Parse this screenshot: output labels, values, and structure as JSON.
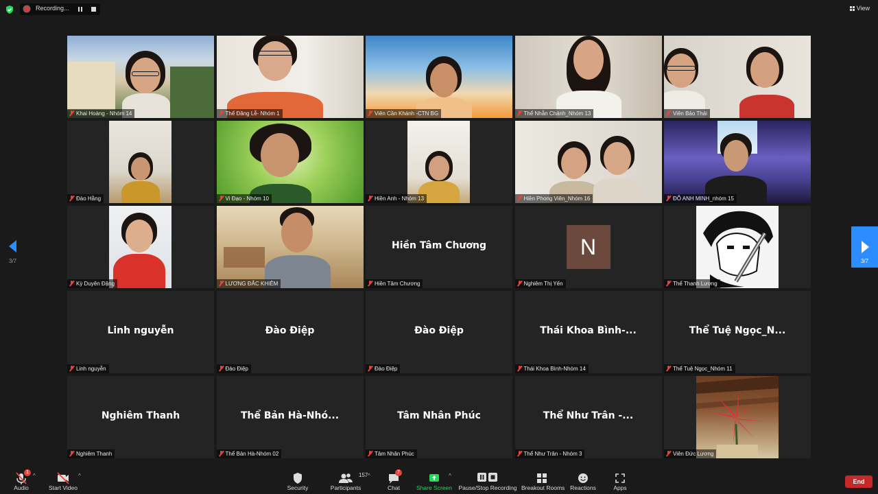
{
  "recording": {
    "label": "Recording..."
  },
  "view_button": {
    "label": "View"
  },
  "pagination": {
    "left": "3/7",
    "right": "3/7"
  },
  "participants": [
    {
      "name": "Khai Hoàng - Nhóm 14",
      "video": true
    },
    {
      "name": "Thể Đăng Lễ- Nhóm 1",
      "video": true
    },
    {
      "name": "Viên Cần Khánh -CTN BG",
      "video": true
    },
    {
      "name": "Thể Nhẫn Chánh_Nhóm 13",
      "video": true
    },
    {
      "name": "Viên Bảo Thái",
      "video": true
    },
    {
      "name": "Đào Hằng",
      "video": true
    },
    {
      "name": "Vi Đạo - Nhóm 10",
      "video": true
    },
    {
      "name": "Hiền Anh - Nhóm 13",
      "video": true
    },
    {
      "name": "Hiền Phong Viên_Nhóm 16",
      "video": true
    },
    {
      "name": "ĐỖ ANH MINH_nhóm 15",
      "video": true
    },
    {
      "name": "Kỳ Duyên Đặng",
      "video": true
    },
    {
      "name": "LƯƠNG ĐẮC KHIÊM",
      "video": true
    },
    {
      "name": "Hiền Tâm Chương",
      "display": "Hiền Tâm Chương"
    },
    {
      "name": "Nghiêm Thị Yến",
      "avatar_letter": "N",
      "avatar_color": "#6b4a3d"
    },
    {
      "name": "Thể Thanh Lương",
      "picture": true
    },
    {
      "name": "Linh nguyễn",
      "display": "Linh nguyễn"
    },
    {
      "name": "Đào Điệp",
      "display": "Đào Điệp"
    },
    {
      "name": "Đào Điệp",
      "display": "Đào Điệp"
    },
    {
      "name": "Thái Khoa Bình-Nhóm 14",
      "display": "Thái Khoa Bình-..."
    },
    {
      "name": "Thể Tuệ Ngọc_Nhóm 11",
      "display": "Thể Tuệ Ngọc_N..."
    },
    {
      "name": "Nghiêm Thanh",
      "display": "Nghiêm Thanh"
    },
    {
      "name": "Thể Bản Hà-Nhóm 02",
      "display": "Thể Bản Hà-Nhó..."
    },
    {
      "name": "Tâm Nhân Phúc",
      "display": "Tâm Nhân Phúc"
    },
    {
      "name": "Thể Như Trân - Nhóm 3",
      "display": "Thể Như Trân -..."
    },
    {
      "name": "Viên Đức Lương",
      "picture": true
    }
  ],
  "toolbar": {
    "audio": "Audio",
    "audio_badge": "1",
    "start_video": "Start Video",
    "security": "Security",
    "participants": "Participants",
    "participants_count": "157",
    "chat": "Chat",
    "chat_badge": "7",
    "share_screen": "Share Screen",
    "recording": "Pause/Stop Recording",
    "breakout_rooms": "Breakout Rooms",
    "reactions": "Reactions",
    "apps": "Apps",
    "end": "End"
  },
  "colors": {
    "accent": "#2d8cff",
    "share": "#23d959",
    "end": "#c52929",
    "muted": "#e5463b"
  }
}
